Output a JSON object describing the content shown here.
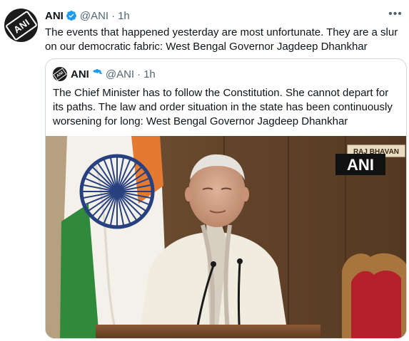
{
  "tweet": {
    "author_name": "ANI",
    "handle": "@ANI",
    "separator": "·",
    "time": "1h",
    "more_label": "•••",
    "text": "The events that happened yesterday are most unfortunate. They are a slur on our democratic fabric: West Bengal Governor Jagdeep Dhankhar",
    "avatar_text": "ANI"
  },
  "quoted": {
    "author_name": "ANI",
    "handle": "@ANI",
    "separator": "·",
    "time": "1h",
    "text": "The Chief Minister has to follow the Constitution. She cannot depart for its paths. The law and order situation in the state has been continuously worsening for long: West Bengal Governor Jagdeep Dhankhar",
    "media": {
      "watermark": "ANI",
      "sign_text": "RAJ BHAVAN"
    }
  },
  "colors": {
    "verified": "#1d9bf0",
    "muted": "#536471",
    "border": "#cfd9de"
  }
}
